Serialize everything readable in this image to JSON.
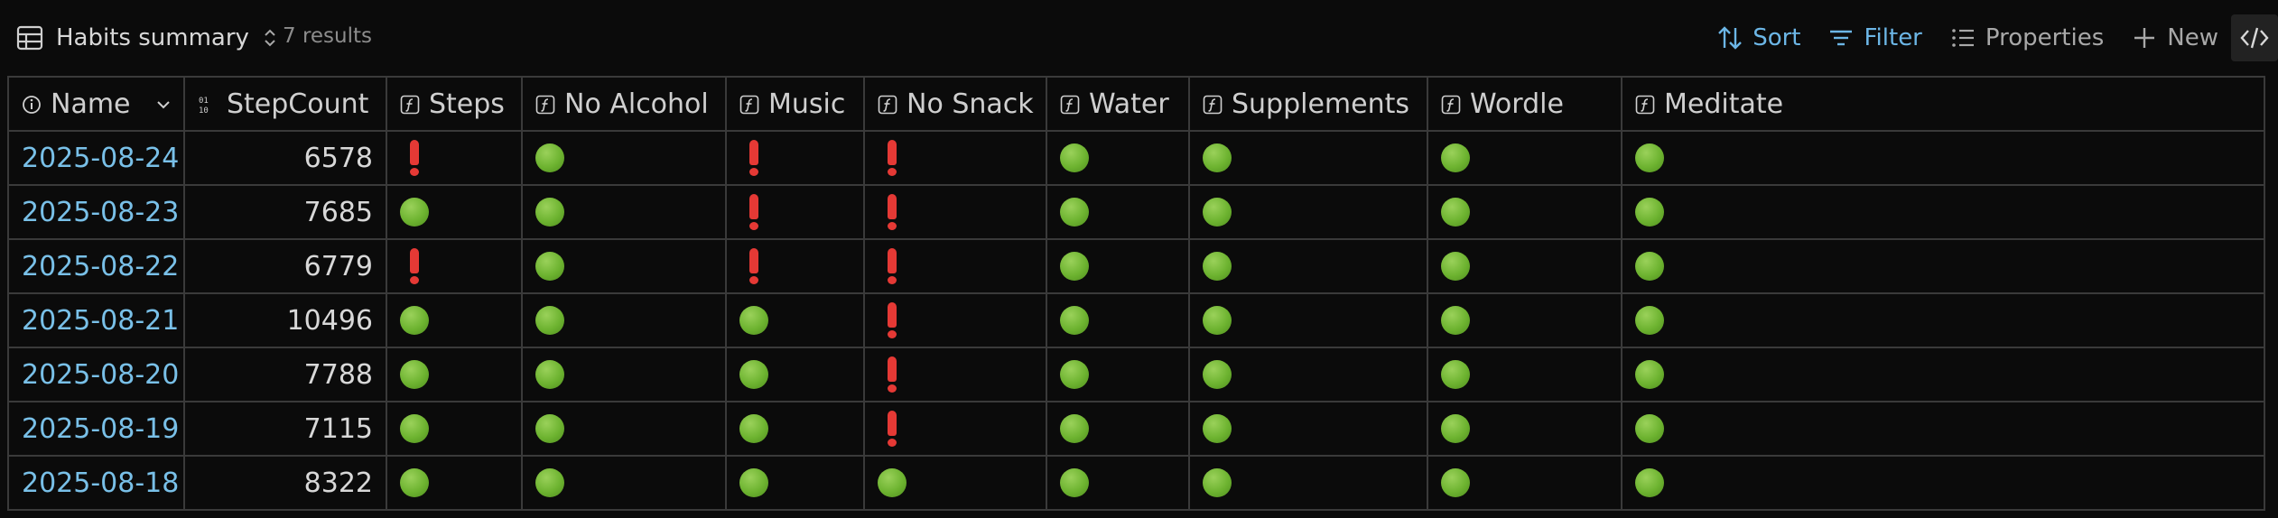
{
  "view": {
    "title": "Habits summary",
    "results_label": "7 results"
  },
  "actions": {
    "sort": "Sort",
    "filter": "Filter",
    "properties": "Properties",
    "new": "New"
  },
  "colors": {
    "accent": "#6cb6e6",
    "done": "#6db330",
    "missed": "#e53935",
    "background": "#0b0b0b"
  },
  "columns": [
    "Name",
    "StepCount",
    "Steps",
    "No Alcohol",
    "Music",
    "No Snack",
    "Water",
    "Supplements",
    "Wordle",
    "Meditate"
  ],
  "status_legend": {
    "done": "green-circle-icon",
    "missed": "red-exclamation-icon"
  },
  "rows": [
    {
      "name": "2025-08-24",
      "step_count": "6578",
      "status": [
        "missed",
        "done",
        "missed",
        "missed",
        "done",
        "done",
        "done",
        "done"
      ]
    },
    {
      "name": "2025-08-23",
      "step_count": "7685",
      "status": [
        "done",
        "done",
        "missed",
        "missed",
        "done",
        "done",
        "done",
        "done"
      ]
    },
    {
      "name": "2025-08-22",
      "step_count": "6779",
      "status": [
        "missed",
        "done",
        "missed",
        "missed",
        "done",
        "done",
        "done",
        "done"
      ]
    },
    {
      "name": "2025-08-21",
      "step_count": "10496",
      "status": [
        "done",
        "done",
        "done",
        "missed",
        "done",
        "done",
        "done",
        "done"
      ]
    },
    {
      "name": "2025-08-20",
      "step_count": "7788",
      "status": [
        "done",
        "done",
        "done",
        "missed",
        "done",
        "done",
        "done",
        "done"
      ]
    },
    {
      "name": "2025-08-19",
      "step_count": "7115",
      "status": [
        "done",
        "done",
        "done",
        "missed",
        "done",
        "done",
        "done",
        "done"
      ]
    },
    {
      "name": "2025-08-18",
      "step_count": "8322",
      "status": [
        "done",
        "done",
        "done",
        "done",
        "done",
        "done",
        "done",
        "done"
      ]
    }
  ]
}
